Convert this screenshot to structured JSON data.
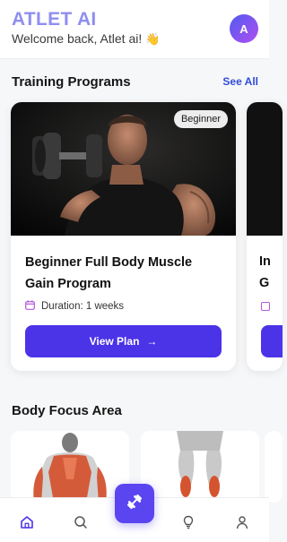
{
  "header": {
    "app_title": "ATLET AI",
    "welcome_text": "Welcome back, Atlet ai!",
    "welcome_emoji": "👋",
    "avatar_initial": "A"
  },
  "training": {
    "section_title": "Training Programs",
    "see_all_label": "See All",
    "programs": [
      {
        "level_badge": "Beginner",
        "title": "Beginner Full Body Muscle Gain Program",
        "duration": "Duration: 1 weeks",
        "button_label": "View Plan",
        "image": "man-lifting-dumbbell-photo"
      },
      {
        "title_partial_line1": "In",
        "title_partial_line2": "G",
        "image": "dark-photo"
      }
    ]
  },
  "body_focus": {
    "section_title": "Body Focus Area",
    "areas": [
      {
        "image": "back-muscles-illustration"
      },
      {
        "image": "calf-muscles-illustration"
      }
    ]
  },
  "bottom_nav": {
    "items": [
      {
        "icon": "home-icon",
        "active": true
      },
      {
        "icon": "search-icon",
        "active": false
      },
      {
        "icon": "dumbbell-icon",
        "active": false
      },
      {
        "icon": "lightbulb-icon",
        "active": false
      },
      {
        "icon": "profile-icon",
        "active": false
      }
    ]
  },
  "colors": {
    "brand_title": "#8f8ef2",
    "primary_button": "#4b33e8",
    "link": "#2f4cd8",
    "nav_active": "#4b33e8",
    "calendar_icon": "#b45ad6"
  }
}
